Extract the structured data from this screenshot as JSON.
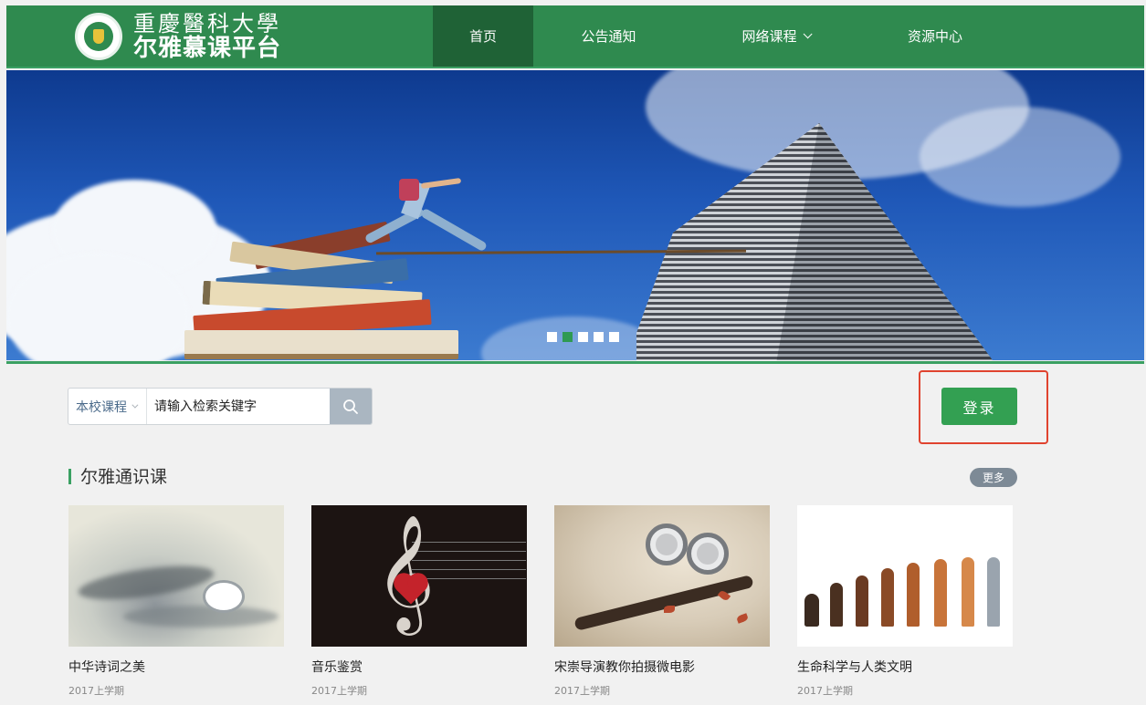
{
  "header": {
    "logo": {
      "school_name": "重慶醫科大學",
      "platform_name": "尔雅慕课平台",
      "emblem_text": "重庆医科大学 Chongqing Medical University"
    },
    "nav": [
      {
        "label": "首页",
        "active": true
      },
      {
        "label": "公告通知",
        "active": false
      },
      {
        "label": "网络课程",
        "active": false,
        "has_dropdown": true
      },
      {
        "label": "资源中心",
        "active": false
      }
    ]
  },
  "banner": {
    "slide_count": 5,
    "active_slide": 2,
    "icon": "carousel-dots"
  },
  "search": {
    "scope_label": "本校课程",
    "placeholder": "请输入检索关键字",
    "icon": "search-icon"
  },
  "login": {
    "label": "登录",
    "highlighted": true,
    "highlight_color": "#e0432f"
  },
  "section": {
    "title": "尔雅通识课",
    "more_label": "更多",
    "courses": [
      {
        "title": "中华诗词之美",
        "term": "2017上学期"
      },
      {
        "title": "音乐鉴赏",
        "term": "2017上学期"
      },
      {
        "title": "宋崇导演教你拍摄微电影",
        "term": "2017上学期"
      },
      {
        "title": "生命科学与人类文明",
        "term": "2017上学期"
      }
    ]
  },
  "colors": {
    "brand_green": "#2f8a4f",
    "nav_active": "#1f6236",
    "accent_green": "#3aa062",
    "login_green": "#33a052",
    "page_bg": "#f1f1f1"
  }
}
